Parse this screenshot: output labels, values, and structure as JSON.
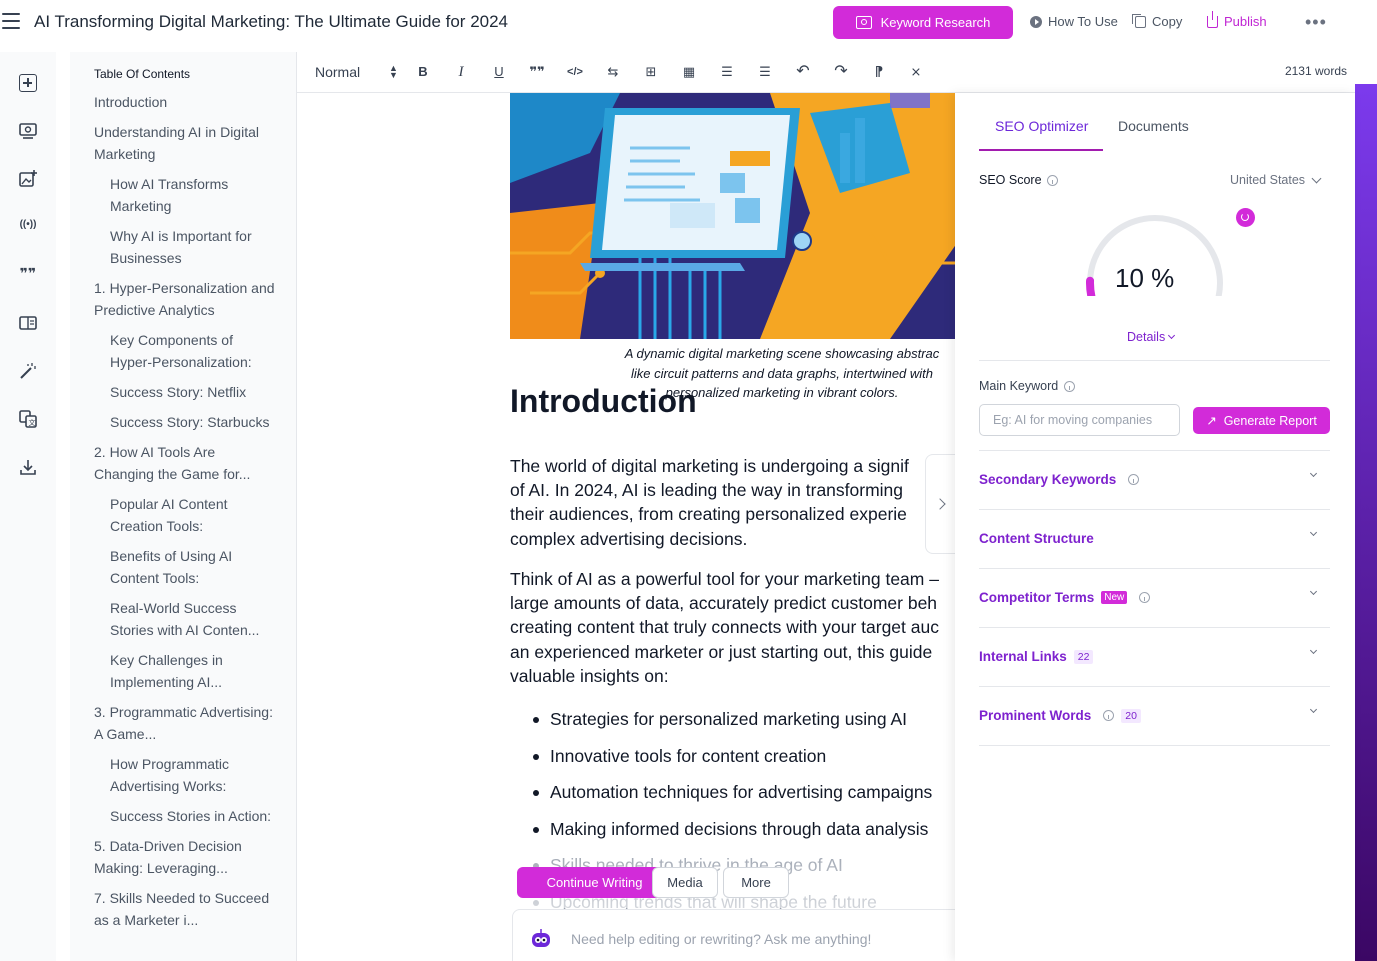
{
  "header": {
    "title": "AI Transforming Digital Marketing: The Ultimate Guide for 2024",
    "keyword_research_label": "Keyword Research",
    "how_to_use_label": "How To Use",
    "copy_label": "Copy",
    "publish_label": "Publish",
    "more_label": "•••"
  },
  "rail": {
    "icons": [
      "add-block-icon",
      "image-search-icon",
      "add-image-icon",
      "broadcast-icon",
      "quote-icon",
      "reader-icon",
      "magic-wand-icon",
      "translate-icon",
      "download-icon"
    ],
    "broadcast_glyph": "((•))",
    "quote_glyph": "❞❞"
  },
  "toc": {
    "title": "Table Of Contents",
    "items": [
      {
        "label": "Introduction",
        "level": 1
      },
      {
        "label": "Understanding AI in Digital Marketing",
        "level": 1
      },
      {
        "label": "How AI Transforms Marketing",
        "level": 2
      },
      {
        "label": "Why AI is Important for Businesses",
        "level": 2
      },
      {
        "label": "1. Hyper-Personalization and Predictive Analytics",
        "level": 1
      },
      {
        "label": "Key Components of Hyper-Personalization:",
        "level": 2
      },
      {
        "label": "Success Story: Netflix",
        "level": 2
      },
      {
        "label": "Success Story: Starbucks",
        "level": 2
      },
      {
        "label": "2. How AI Tools Are Changing the Game for...",
        "level": 1
      },
      {
        "label": "Popular AI Content Creation Tools:",
        "level": 2
      },
      {
        "label": "Benefits of Using AI Content Tools:",
        "level": 2
      },
      {
        "label": "Real-World Success Stories with AI Conten...",
        "level": 2
      },
      {
        "label": "Key Challenges in Implementing AI...",
        "level": 2
      },
      {
        "label": "3. Programmatic Advertising: A Game...",
        "level": 1
      },
      {
        "label": "How Programmatic Advertising Works:",
        "level": 2
      },
      {
        "label": "Success Stories in Action:",
        "level": 2
      },
      {
        "label": "5. Data-Driven Decision Making: Leveraging...",
        "level": 1
      },
      {
        "label": "7. Skills Needed to Succeed as a Marketer i...",
        "level": 1
      }
    ]
  },
  "toolbar": {
    "style_label": "Normal",
    "updown_glyph": "▲\n▼",
    "bold": "B",
    "italic": "I",
    "underline": "U",
    "quote": "❞❞",
    "code": "</>",
    "link": "⇆",
    "image": "⊞",
    "video": "▦",
    "ordered_list": "☰",
    "bullet_list": "☰",
    "undo": "↶",
    "redo": "↷",
    "rtl": "⁋",
    "clear_format": "⨯",
    "word_count": "2131 words"
  },
  "editor": {
    "caption": "A dynamic digital marketing scene showcasing abstrac\nlike circuit patterns and data graphs, intertwined with\npersonalized marketing in vibrant colors.",
    "heading": "Introduction",
    "para1": "The world of digital marketing is undergoing a signif\nof AI. In 2024, AI is leading the way in transforming\ntheir audiences, from creating personalized experie\ncomplex advertising decisions.",
    "para2": "Think of AI as a powerful tool for your marketing team –\nlarge amounts of data, accurately predict customer beh\ncreating content that truly connects with your target auc\nan experienced marketer or just starting out, this guide\nvaluable insights on:",
    "bullets": [
      "Strategies for personalized marketing using AI",
      "Innovative tools for content creation",
      "Automation techniques for advertising campaigns",
      "Making informed decisions through data analysis",
      "Skills needed to thrive in the age of AI",
      "Upcoming trends that will shape the future"
    ],
    "continue_writing_label": "Continue Writing",
    "media_label": "Media",
    "more_label": "More",
    "ask_placeholder": "Need help editing or rewriting? Ask me anything!"
  },
  "seo": {
    "tab_optimizer": "SEO Optimizer",
    "tab_documents": "Documents",
    "score_label": "SEO Score",
    "country": "United States",
    "score_percent": 10,
    "score_text": "10 %",
    "details_label": "Details",
    "main_keyword_label": "Main Keyword",
    "main_keyword_placeholder": "Eg: AI for moving companies",
    "main_keyword_value": "",
    "generate_label": "Generate Report",
    "generate_glyph": "↗",
    "sections": [
      {
        "title": "Secondary Keywords",
        "info": true,
        "badge": "",
        "badge_type": ""
      },
      {
        "title": "Content Structure",
        "info": false,
        "badge": "",
        "badge_type": ""
      },
      {
        "title": "Competitor Terms",
        "info": true,
        "badge": "New",
        "badge_type": "new"
      },
      {
        "title": "Internal Links",
        "info": false,
        "badge": "22",
        "badge_type": "count"
      },
      {
        "title": "Prominent Words",
        "info": true,
        "badge": "20",
        "badge_type": "count"
      }
    ]
  },
  "colors": {
    "accent": "#d22bd9",
    "accent_text": "#7e22ce",
    "gauge_track": "#e5e7eb"
  }
}
